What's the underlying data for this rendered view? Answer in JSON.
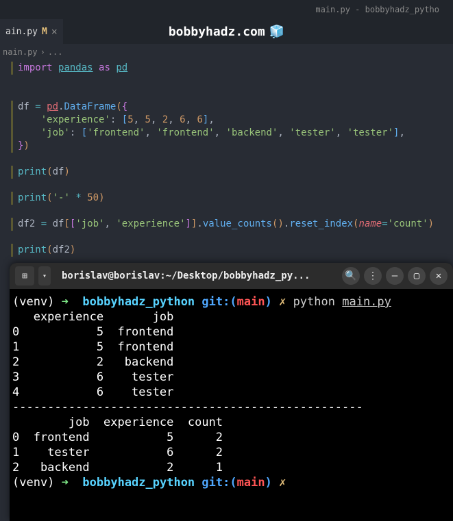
{
  "window": {
    "title": "main.py - bobbyhadz_pytho"
  },
  "tab": {
    "filename": "ain.py",
    "modified_marker": "M",
    "close": "×"
  },
  "overlay": {
    "text": "bobbyhadz.com",
    "emoji": "🧊"
  },
  "breadcrumb": {
    "file": "nain.py",
    "sep": "›",
    "more": "..."
  },
  "code": {
    "import": "import",
    "pandas": "pandas",
    "as": "as",
    "pd": "pd",
    "df": "df",
    "eq": "=",
    "dot": ".",
    "DataFrame": "DataFrame",
    "lbrace": "{",
    "rbrace": "}",
    "lparen": "(",
    "rparen": ")",
    "lbrack": "[",
    "rbrack": "]",
    "experience": "'experience'",
    "job": "'job'",
    "colon": ":",
    "comma": ",",
    "n5a": "5",
    "n5b": "5",
    "n2": "2",
    "n6a": "6",
    "n6b": "6",
    "frontend": "'frontend'",
    "backend": "'backend'",
    "tester": "'tester'",
    "print": "print",
    "dash": "'-'",
    "star": "*",
    "fifty": "50",
    "df2": "df2",
    "value_counts": "value_counts",
    "reset_index": "reset_index",
    "name_kw": "name",
    "count": "'count'"
  },
  "terminal": {
    "header": {
      "new_tab_icon": "⊞",
      "dropdown": "▾",
      "title": "borislav@borislav:~/Desktop/bobbyhadz_py...",
      "search": "🔍",
      "menu": "⋮",
      "min": "—",
      "max": "▢",
      "close": "✕"
    },
    "prompt": {
      "venv": "(venv)",
      "arrow": "➜",
      "dir": "bobbyhadz_python",
      "git": "git:(",
      "branch": "main",
      "gitclose": ")",
      "x": "✗",
      "python": "python",
      "file": "main.py"
    },
    "output1": {
      "header": "   experience       job",
      "r0": "0           5  frontend",
      "r1": "1           5  frontend",
      "r2": "2           2   backend",
      "r3": "3           6    tester",
      "r4": "4           6    tester"
    },
    "sep": "--------------------------------------------------",
    "output2": {
      "header": "        job  experience  count",
      "r0": "0  frontend           5      2",
      "r1": "1    tester           6      2",
      "r2": "2   backend           2      1"
    }
  }
}
